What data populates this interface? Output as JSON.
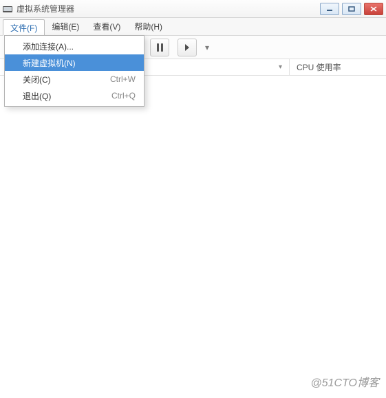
{
  "window": {
    "title": "虚拟系统管理器"
  },
  "menubar": {
    "file": "文件(F)",
    "edit": "编辑(E)",
    "view": "查看(V)",
    "help": "帮助(H)"
  },
  "dropdown": {
    "items": [
      {
        "label": "添加连接(A)...",
        "accel": ""
      },
      {
        "label": "新建虚拟机(N)",
        "accel": ""
      },
      {
        "label": "关闭(C)",
        "accel": "Ctrl+W"
      },
      {
        "label": "退出(Q)",
        "accel": "Ctrl+Q"
      }
    ],
    "selected_index": 1
  },
  "columns": {
    "cpu": "CPU 使用率"
  },
  "watermark": "@51CTO博客"
}
